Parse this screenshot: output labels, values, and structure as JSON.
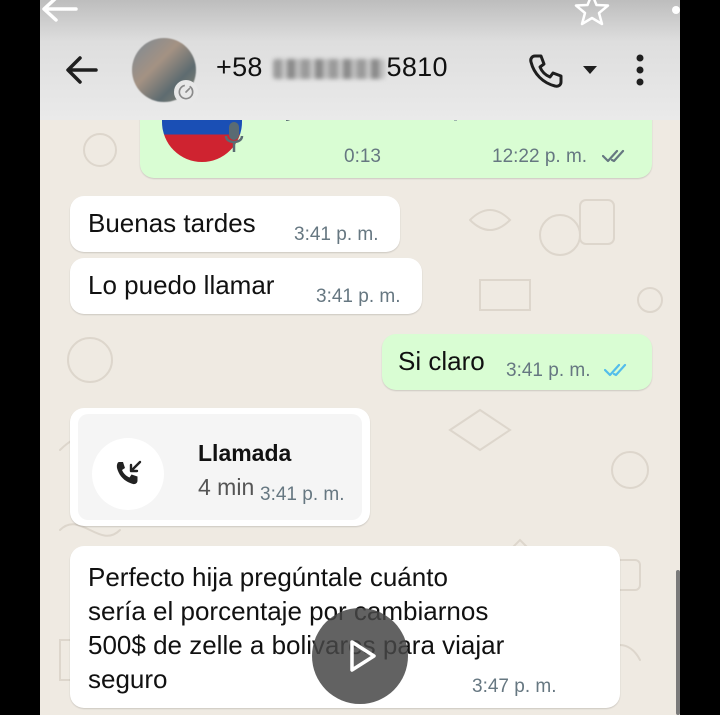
{
  "header": {
    "contact_number_prefix": "+58",
    "contact_number_suffix": "5810",
    "icons": {
      "status_back": "arrow-left-icon",
      "status_star": "star-icon",
      "back": "arrow-left-icon",
      "call": "phone-icon",
      "call_menu": "caret-down-icon",
      "overflow": "more-vertical-icon"
    }
  },
  "messages": {
    "voice_note": {
      "duration": "0:13",
      "time": "12:22 p. m.",
      "status": "read-gray"
    },
    "m1": {
      "text": "Buenas tardes",
      "time": "3:41 p. m."
    },
    "m2": {
      "text": "Lo puedo llamar",
      "time": "3:41 p. m."
    },
    "m3": {
      "text": "Si claro",
      "time": "3:41 p. m.",
      "status": "read-blue"
    },
    "call": {
      "title": "Llamada",
      "duration": "4 min",
      "time": "3:41 p. m.",
      "icon": "incoming-call-icon"
    },
    "m4": {
      "line1": "Perfecto hija pregúntale cuánto",
      "line2": "sería el porcentaje por cambiarnos",
      "line3": "500$ de zelle a bolivares para viajar",
      "line4": "seguro",
      "time": "3:47 p. m."
    }
  },
  "colors": {
    "background": "#efeae2",
    "incoming_bubble": "#ffffff",
    "outgoing_bubble": "#d9fdd3",
    "read_tick_blue": "#53bdeb",
    "time_gray": "#667781"
  }
}
